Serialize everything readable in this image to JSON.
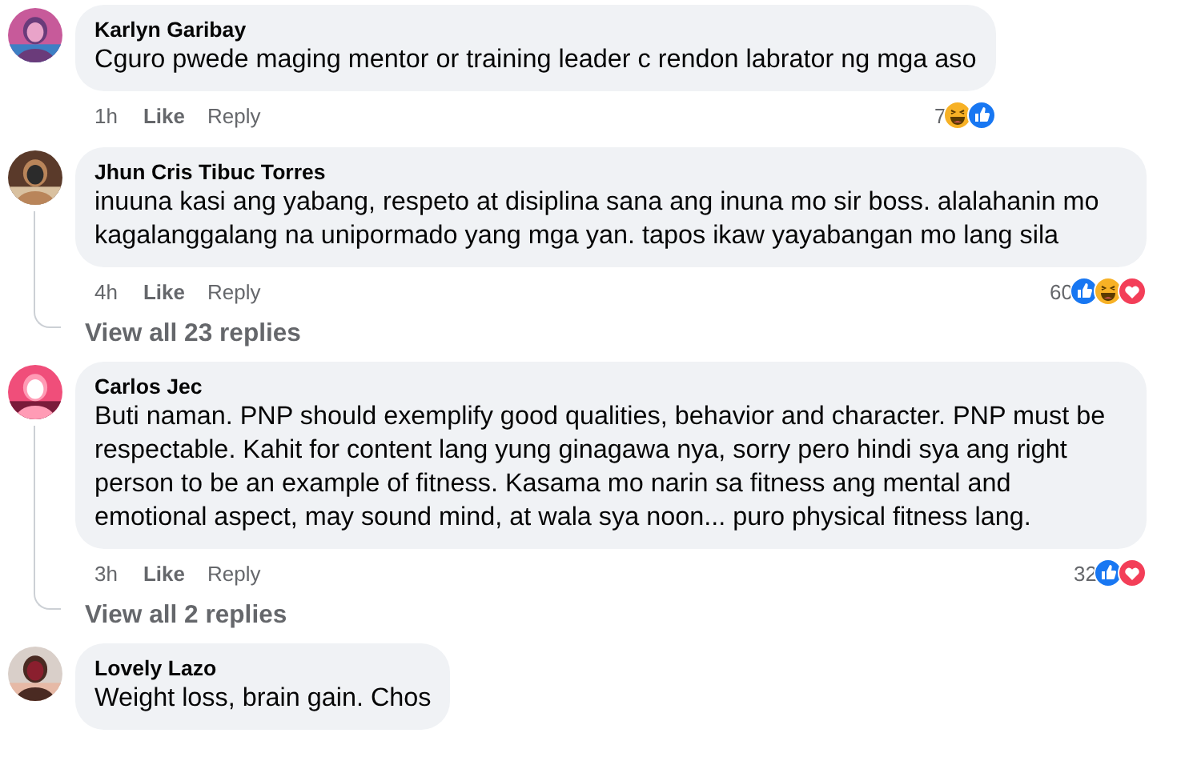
{
  "comments": [
    {
      "author": "Karlyn Garibay",
      "text": "Cguro pwede maging mentor or training leader c rendon labrator ng mga aso",
      "time": "1h",
      "like": "Like",
      "reply": "Reply",
      "reaction_count": "7",
      "reactions": [
        {
          "kind": "haha"
        },
        {
          "kind": "like"
        }
      ],
      "avatar": {
        "kind": "picture"
      }
    },
    {
      "author": "Jhun Cris Tibuc Torres",
      "text": "inuuna kasi ang yabang, respeto at disiplina sana ang inuna mo sir boss. alalahanin mo kagalanggalang na unipormado yang mga yan. tapos ikaw yayabangan mo lang sila",
      "time": "4h",
      "like": "Like",
      "reply": "Reply",
      "reaction_count": "60",
      "reactions": [
        {
          "kind": "like"
        },
        {
          "kind": "haha"
        },
        {
          "kind": "love"
        }
      ],
      "view_replies": "View all 23 replies",
      "avatar": {
        "kind": "picture"
      }
    },
    {
      "author": "Carlos Jec",
      "text": "Buti naman. PNP should exemplify good qualities, behavior and character. PNP must be respectable. Kahit for content lang yung ginagawa nya, sorry pero hindi sya ang right person to be an example of fitness. Kasama mo narin sa fitness ang mental and emotional aspect, may sound mind, at wala sya noon... puro physical fitness lang.",
      "time": "3h",
      "like": "Like",
      "reply": "Reply",
      "reaction_count": "32",
      "reactions": [
        {
          "kind": "like"
        },
        {
          "kind": "love"
        }
      ],
      "view_replies": "View all 2 replies",
      "avatar": {
        "kind": "picture"
      }
    },
    {
      "author": "Lovely Lazo",
      "text": "Weight loss, brain gain. Chos",
      "avatar": {
        "kind": "picture"
      }
    }
  ]
}
